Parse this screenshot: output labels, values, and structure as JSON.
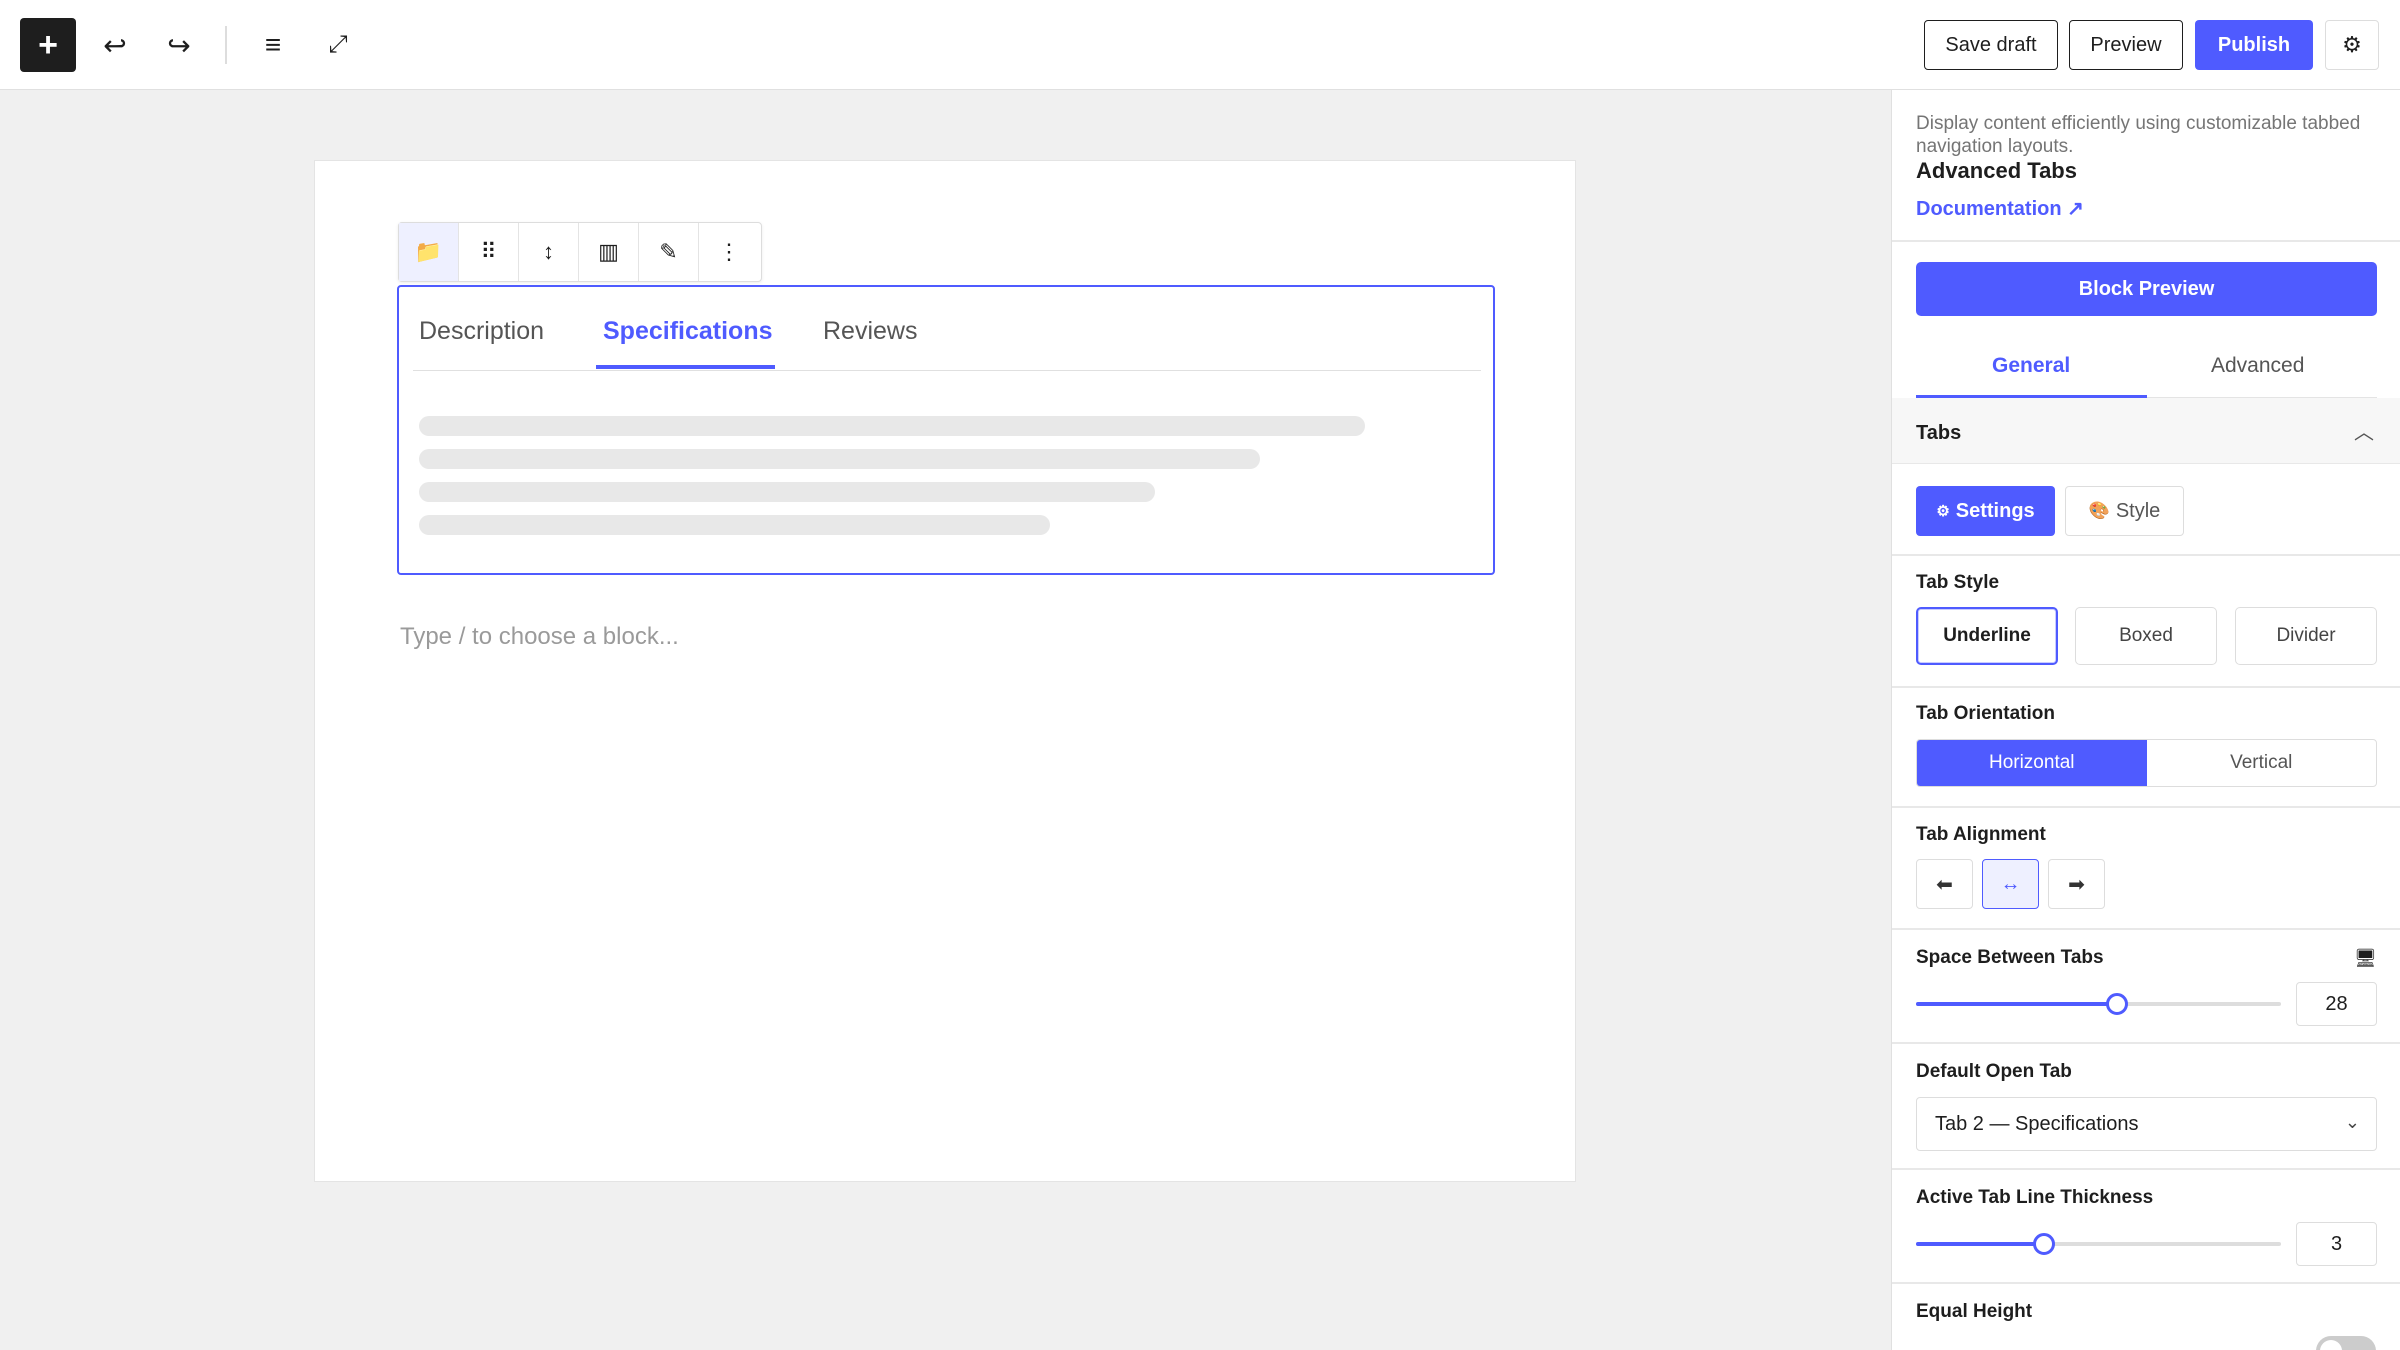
{
  "toolbar": {
    "inserter_icon": "+",
    "undo_icon": "↩",
    "redo_icon": "↪",
    "list_view_icon": "≡",
    "fullscreen_icon": "⤢",
    "save_draft_label": "Save draft",
    "preview_label": "Preview",
    "publish_label": "Publish",
    "settings_icon": "⚙"
  },
  "block_toolbar": {
    "items": [
      {
        "name": "block-type-icon",
        "glyph": "📁"
      },
      {
        "name": "drag-handle-icon",
        "glyph": "⠿"
      },
      {
        "name": "move-icon",
        "glyph": "↕"
      },
      {
        "name": "align-icon",
        "glyph": "▥"
      },
      {
        "name": "edit-icon",
        "glyph": "✎"
      },
      {
        "name": "more-options-icon",
        "glyph": "⋮"
      }
    ]
  },
  "editor": {
    "tabs": [
      "Description",
      "Specifications",
      "Reviews"
    ],
    "active_tab": "Specifications",
    "placeholder": "Type / to choose a block..."
  },
  "sidebar": {
    "description": "Display content efficiently using customizable tabbed navigation layouts.",
    "title": "Advanced Tabs",
    "documentation_label": "Documentation ↗",
    "block_preview_label": "Block Preview",
    "tabs": [
      "General",
      "Advanced"
    ],
    "panel_title": "Tabs",
    "panel_chevron": "︿",
    "settings_label": "Settings",
    "settings_icon": "⚙",
    "style_label": "Style",
    "style_icon": "🎨",
    "tab_style": {
      "label": "Tab Style",
      "options": [
        "Underline",
        "Boxed",
        "Divider"
      ],
      "selected": "Underline"
    },
    "tab_orientation": {
      "label": "Tab Orientation",
      "options": [
        "Horizontal",
        "Vertical"
      ],
      "selected": "Horizontal"
    },
    "tab_alignment": {
      "label": "Tab Alignment",
      "options": [
        "⬅",
        "↔",
        "➡"
      ],
      "selected_index": 1
    },
    "space_between": {
      "label": "Space Between Tabs",
      "device_icon": "🖥",
      "value": "28",
      "fraction": 0.55
    },
    "default_open": {
      "label": "Default Open Tab",
      "value": "Tab 2 — Specifications",
      "caret": "⌄"
    },
    "line_thickness": {
      "label": "Active Tab Line Thickness",
      "value": "3",
      "fraction": 0.35
    },
    "equal_height": {
      "label": "Equal Height",
      "enabled": false
    }
  },
  "colors": {
    "accent": "#4f5bff",
    "dark": "#1e1e1e",
    "canvas_bg": "#f0f0f0"
  }
}
